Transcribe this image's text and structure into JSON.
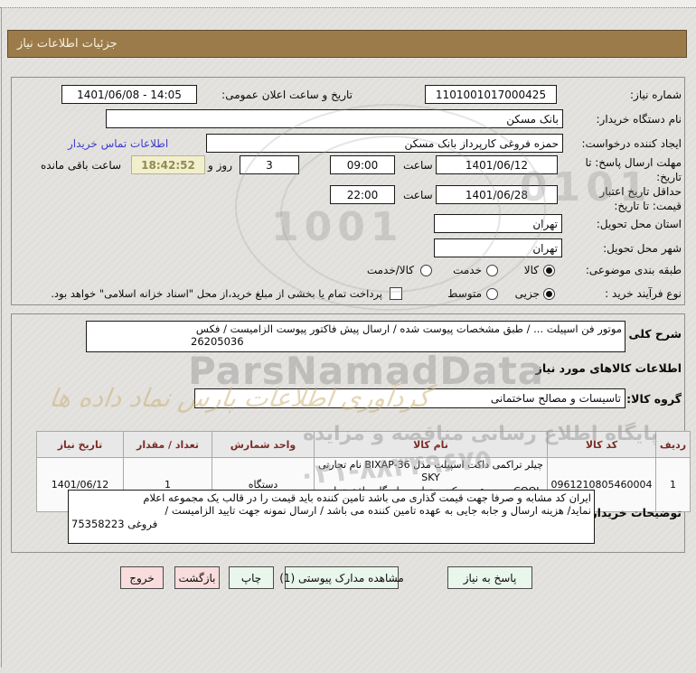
{
  "colors": {
    "titlebar_bg": "#9c7b4a",
    "link_blue": "#3d3dcb",
    "timer_bg": "#f2efcd",
    "table_header_text": "#7b2c25",
    "button_green": "#e9f6ec",
    "button_pink": "#f9dcdc"
  },
  "title_bar": {
    "title": "جزئیات اطلاعات نیاز"
  },
  "form": {
    "need_number": {
      "label": "شماره نیاز:",
      "value": "1101001017000425"
    },
    "announce_datetime": {
      "label": "تاریخ و ساعت اعلان عمومی:",
      "value": "1401/06/08 - 14:05"
    },
    "buyer_org": {
      "label": "نام دستگاه خریدار:",
      "value": "بانک مسکن"
    },
    "request_creator": {
      "label": "ایجاد کننده درخواست:",
      "value": "حمزه فروغی کارپرداز بانک مسکن",
      "contact_link": "اطلاعات تماس خریدار"
    },
    "reply_deadline": {
      "label": "مهلت ارسال پاسخ: تا تاریخ:",
      "date": "1401/06/12",
      "hour_label": "ساعت",
      "time": "09:00",
      "days_value": "3",
      "days_label": "روز و",
      "countdown": "18:42:52",
      "remaining_label": "ساعت باقی مانده"
    },
    "price_validity": {
      "label": "حداقل تاریخ اعتبار قیمت: تا تاریخ:",
      "date": "1401/06/28",
      "hour_label": "ساعت",
      "time": "22:00"
    },
    "delivery_province": {
      "label": "استان محل تحویل:",
      "value": "تهران"
    },
    "delivery_city": {
      "label": "شهر محل تحویل:",
      "value": "تهران"
    },
    "subject_class": {
      "label": "طبقه بندی موضوعی:",
      "options": [
        {
          "label": "کالا",
          "selected": true
        },
        {
          "label": "خدمت",
          "selected": false
        },
        {
          "label": "کالا/خدمت",
          "selected": false
        }
      ]
    },
    "purchase_type": {
      "label": "نوع فرآیند خرید :",
      "options": [
        {
          "label": "جزیی",
          "selected": true
        },
        {
          "label": "متوسط",
          "selected": false
        }
      ],
      "treasury_checkbox_label": "پرداخت تمام یا بخشی از مبلغ خرید،از محل \"اسناد خزانه اسلامی\" خواهد بود.",
      "treasury_checked": false
    }
  },
  "details": {
    "need_desc": {
      "label": "شرح کلی نیاز:",
      "line1": "موتور فن اسپیلت ... / طبق مشخصات پیوست شده / ارسال پیش فاکتور پیوست الزامیست / فکس",
      "line2": "26205036"
    },
    "items_heading": "اطلاعات کالاهای مورد نیاز",
    "goods_group": {
      "label": "گروه کالا:",
      "value": "تاسیسات و مصالح ساختمانی"
    },
    "table": {
      "headers": [
        "ردیف",
        "کد کالا",
        "نام کالا",
        "واحد شمارش",
        "تعداد / مقدار",
        "تاریخ نیاز"
      ],
      "rows": [
        {
          "row_no": "1",
          "code": "0961210805460004",
          "name_line1": "چیلر تراکمی داکت اسپیلت مدل BIXAP-36 نام تجارتی SKY",
          "name_line2": "COOL مرجع عرضه کننده تولیدی بازرگانی افق تجارت امرتات",
          "unit": "دستگاه",
          "qty": "1",
          "need_date": "1401/06/12"
        }
      ]
    },
    "buyer_notes": {
      "label": "توضیحات خریدار:",
      "line1": "ایران کد مشابه و صرفا جهت قیمت گذاری می باشد تامین کننده باید قیمت را در قالب یک مجموعه اعلام",
      "line2": "نماید/ هزینه ارسال و جابه جایی به عهده تامین کننده می باشد / ارسال نمونه جهت تایید الزامیست /",
      "line3": "فروغی 75358223"
    }
  },
  "buttons": {
    "reply": "پاسخ به نیاز",
    "view_attachments": "مشاهده مدارک پیوستی (1)",
    "print": "چاپ",
    "back": "بازگشت",
    "exit": "خروج"
  },
  "watermarks": {
    "brand": "ParsNamadData",
    "fa_calligraphy": "گردآوری اطلاعات پارس نماد داده ها",
    "portal": "پایگاه اطلاع رسانی مناقصه و مزایده",
    "phone": "۰۲۱-۸۸۳۴۹۶۷۵",
    "digits1": "0101",
    "digits2": "1001"
  }
}
